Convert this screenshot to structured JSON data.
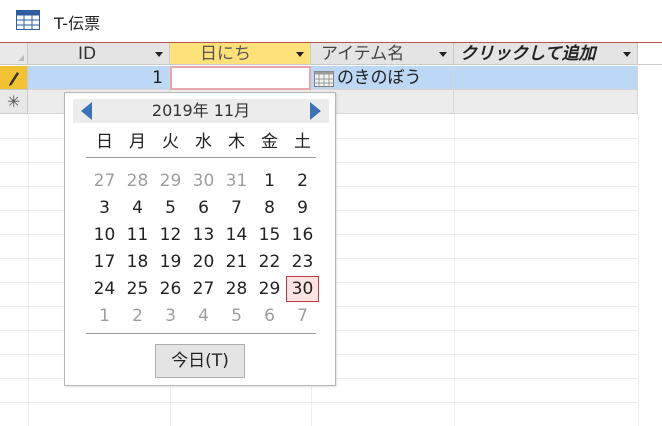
{
  "window": {
    "title": "T-伝票"
  },
  "columns": [
    {
      "label": "ID"
    },
    {
      "label": "日にち"
    },
    {
      "label": "アイテム名"
    },
    {
      "label": "クリックして追加"
    }
  ],
  "rows": [
    {
      "id": "1",
      "date": "",
      "item": "のきのぼう"
    }
  ],
  "new_row_marker": "✳",
  "datepicker": {
    "month_label": "2019年 11月",
    "weekdays": [
      "日",
      "月",
      "火",
      "水",
      "木",
      "金",
      "土"
    ],
    "weeks": [
      [
        "27",
        "28",
        "29",
        "30",
        "31",
        "1",
        "2"
      ],
      [
        "3",
        "4",
        "5",
        "6",
        "7",
        "8",
        "9"
      ],
      [
        "10",
        "11",
        "12",
        "13",
        "14",
        "15",
        "16"
      ],
      [
        "17",
        "18",
        "19",
        "20",
        "21",
        "22",
        "23"
      ],
      [
        "24",
        "25",
        "26",
        "27",
        "28",
        "29",
        "30"
      ],
      [
        "1",
        "2",
        "3",
        "4",
        "5",
        "6",
        "7"
      ]
    ],
    "today_button": "今日(T)"
  },
  "colors": {
    "accent_header": "#ffe17a",
    "selected_row": "#bcd8f5",
    "today_border": "#c33a45",
    "nav_arrow": "#3b72b8"
  }
}
